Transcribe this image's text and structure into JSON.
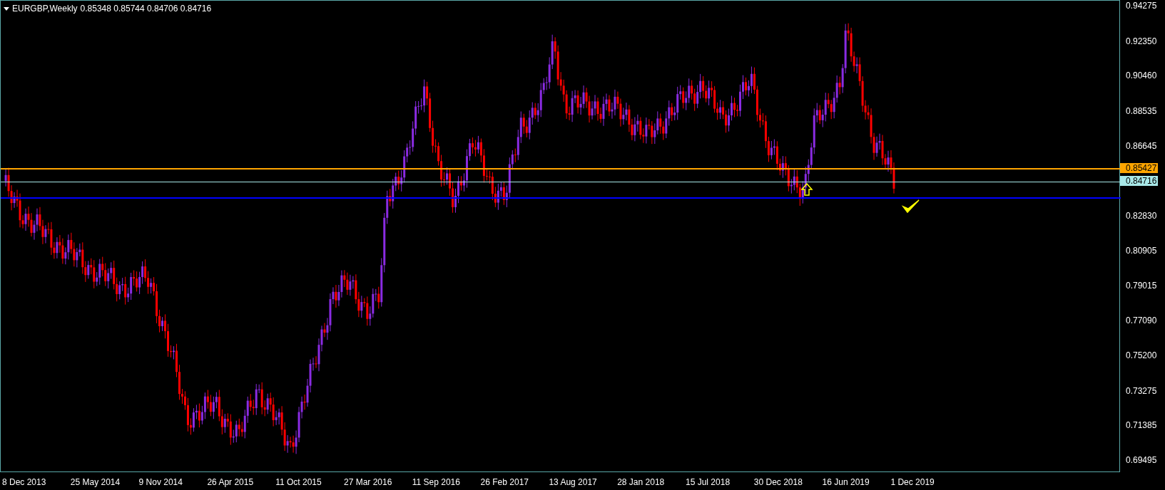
{
  "header": {
    "symbol": "EURGBP,Weekly",
    "quotes": "0.85348 0.85744 0.84706 0.84716"
  },
  "y_axis": {
    "labels": [
      "0.94275",
      "0.92350",
      "0.90460",
      "0.88535",
      "0.86645",
      "0.82830",
      "0.80905",
      "0.79015",
      "0.77090",
      "0.75200",
      "0.73275",
      "0.71385",
      "0.69495"
    ]
  },
  "x_axis": {
    "labels": [
      "8 Dec 2013",
      "25 May 2014",
      "9 Nov 2014",
      "26 Apr 2015",
      "11 Oct 2015",
      "27 Mar 2016",
      "11 Sep 2016",
      "26 Feb 2017",
      "13 Aug 2017",
      "28 Jan 2018",
      "15 Jul 2018",
      "30 Dec 2018",
      "16 Jun 2019",
      "1 Dec 2019"
    ]
  },
  "lines": [
    {
      "kind": "tagged",
      "color": "#ffa500",
      "tag": "0.85427"
    },
    {
      "kind": "tagged",
      "color": "#a8e8e8",
      "tag": "0.84716"
    },
    {
      "kind": "plain",
      "color": "#0000ff"
    }
  ]
}
